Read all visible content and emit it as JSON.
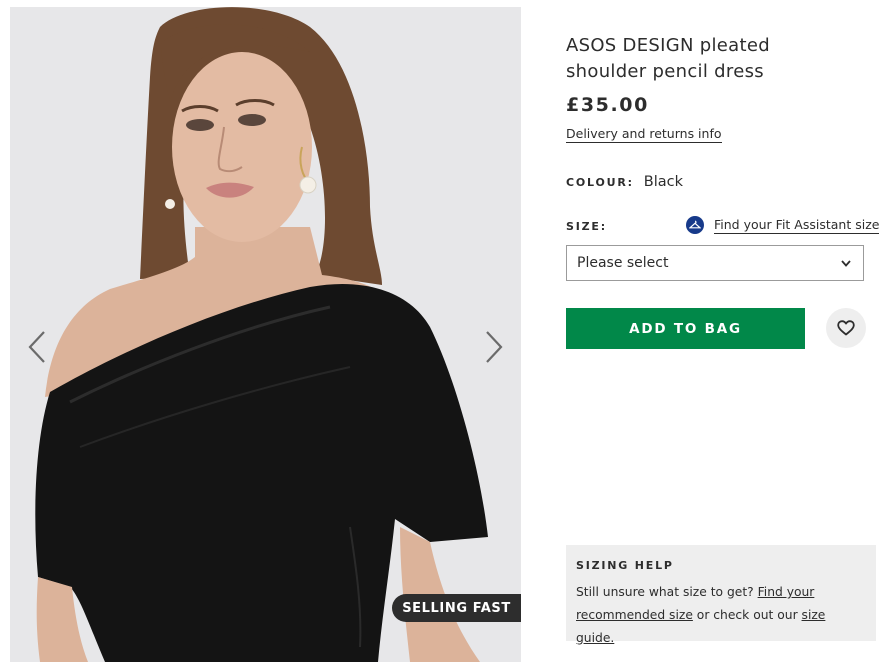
{
  "gallery": {
    "prev_icon": "chevron-left-icon",
    "next_icon": "chevron-right-icon",
    "badge": "SELLING FAST"
  },
  "product": {
    "brand": "ASOS DESIGN",
    "title_rest": " pleated shoulder pencil dress",
    "price": "£35.00",
    "delivery_link": "Delivery and returns info",
    "colour_label": "COLOUR:",
    "colour_value": "Black",
    "size_label": "SIZE:",
    "fit_assistant_icon": "hanger-icon",
    "fit_assistant_link": "Find your Fit Assistant size",
    "size_select": {
      "value": "Please select",
      "icon": "chevron-down-icon"
    },
    "add_to_bag": "ADD TO BAG",
    "save_icon": "heart-icon"
  },
  "sizing_help": {
    "title": "SIZING HELP",
    "text_1": "Still unsure what size to get? ",
    "link_1": "Find your recommended size",
    "text_2": " or check out our ",
    "link_2": "size guide."
  },
  "colors": {
    "accent_green": "#018849",
    "text_dark": "#2d2d2d",
    "fit_icon_blue": "#173a8a",
    "panel_grey": "#eeeeee"
  }
}
